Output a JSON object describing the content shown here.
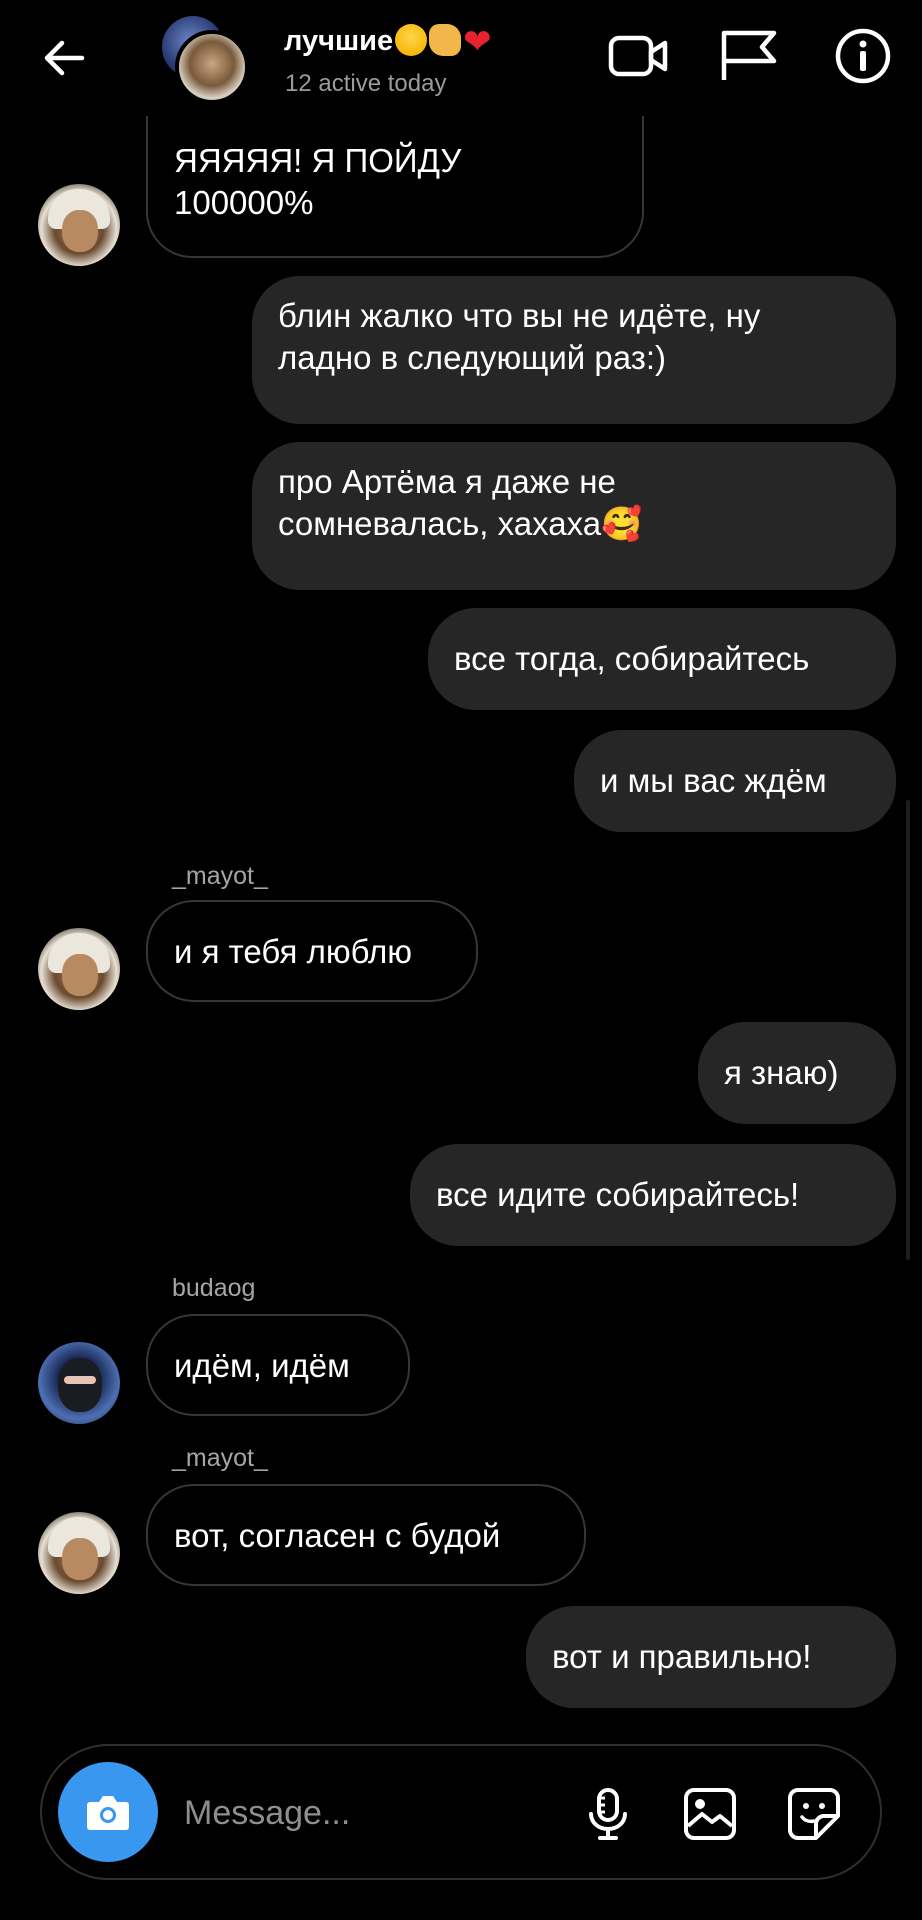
{
  "header": {
    "title": "лучшие",
    "subtitle": "12 active today",
    "icons": [
      "back-arrow-icon",
      "video-call-icon",
      "flag-icon",
      "info-icon"
    ]
  },
  "messages": [
    {
      "direction": "in",
      "sender": "",
      "text_lines": [
        "ЯЯЯЯЯ! Я ПОЙДУ",
        "100000%"
      ]
    },
    {
      "direction": "out",
      "text_lines": [
        "блин жалко что вы не идёте, ну",
        "ладно в следующий раз:)"
      ]
    },
    {
      "direction": "out",
      "text_lines": [
        "про Артёма я даже не",
        "сомневалась, хахаха🥰"
      ]
    },
    {
      "direction": "out",
      "text_lines": [
        "все тогда, собирайтесь"
      ]
    },
    {
      "direction": "out",
      "text_lines": [
        "и мы вас ждём"
      ]
    },
    {
      "direction": "in",
      "sender": "_mayot_",
      "text_lines": [
        "и я тебя люблю"
      ]
    },
    {
      "direction": "out",
      "text_lines": [
        "я знаю)"
      ]
    },
    {
      "direction": "out",
      "text_lines": [
        "все идите собирайтесь!"
      ]
    },
    {
      "direction": "in",
      "sender": "budaog",
      "text_lines": [
        "идём, идём"
      ]
    },
    {
      "direction": "in",
      "sender": "_mayot_",
      "text_lines": [
        "вот, согласен с будой"
      ]
    },
    {
      "direction": "out",
      "text_lines": [
        "вот и правильно!"
      ]
    }
  ],
  "composer": {
    "placeholder": "Message...",
    "icons": [
      "camera-icon",
      "microphone-icon",
      "gallery-icon",
      "sticker-icon"
    ]
  },
  "colors": {
    "background": "#000000",
    "bubble_out": "#262626",
    "bubble_in_border": "#363636",
    "camera_button": "#3a97f0",
    "secondary_text": "#9b9b9b"
  }
}
